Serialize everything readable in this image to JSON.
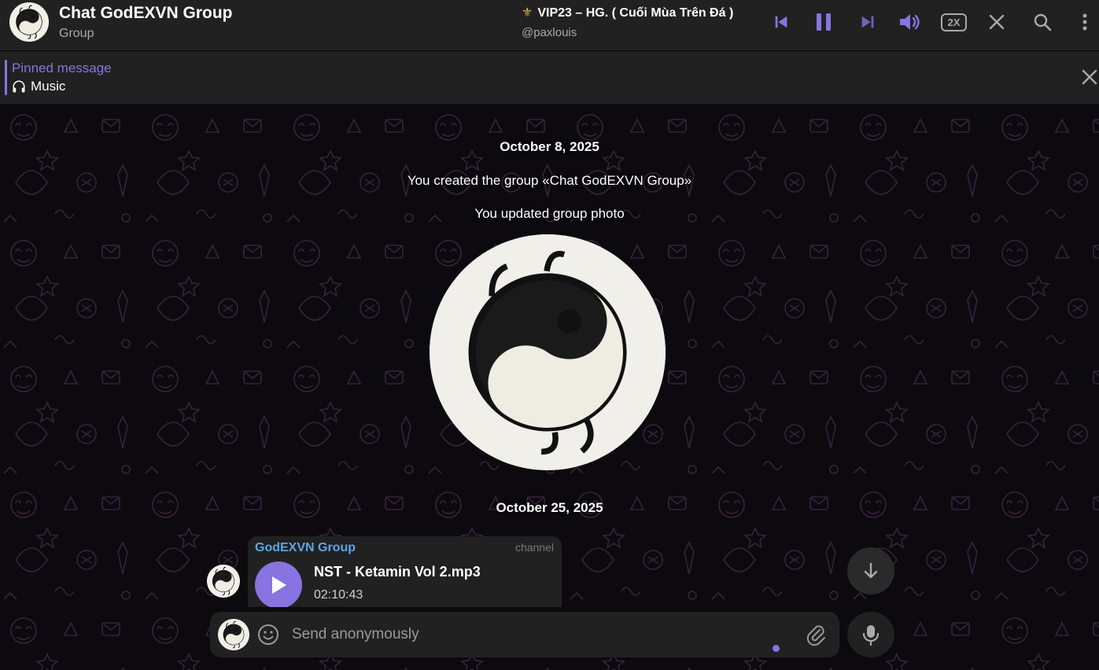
{
  "header": {
    "title": "Chat GodEXVN Group",
    "subtitle": "Group",
    "avatar_icon": "yin-yang-icon"
  },
  "audio_player": {
    "title": "VIP23 – HG. ( Cuối Mùa Trên Đá )",
    "performer": "@paxlouis",
    "speed": "2X",
    "accent_color": "#8774e1"
  },
  "pinned": {
    "title": "Pinned message",
    "text": "Music",
    "icon": "headphones-icon"
  },
  "chat": {
    "date1": "October 8, 2025",
    "event1": "You created the group «Chat GodEXVN Group»",
    "event2": "You updated group photo",
    "date2": "October 25, 2025",
    "message": {
      "sender": "GodEXVN Group",
      "badge": "channel",
      "file_name": "NST - Ketamin Vol 2.mp3",
      "duration": "02:10:43"
    }
  },
  "composer": {
    "placeholder": "Send anonymously"
  },
  "colors": {
    "background": "#0c0a0f",
    "panel": "#212121",
    "accent": "#8774e1",
    "sender": "#5da5e9"
  }
}
